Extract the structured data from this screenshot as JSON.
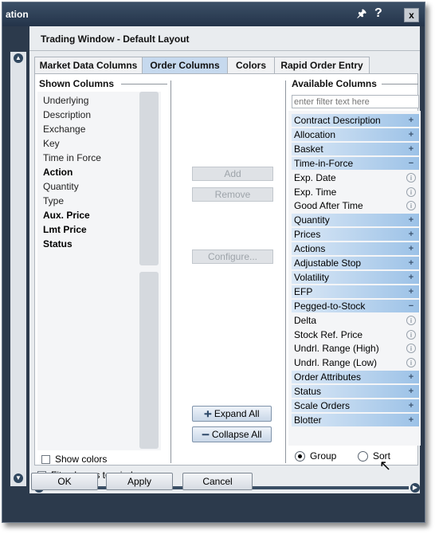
{
  "window": {
    "title": "ation",
    "pin_glyph": "▼",
    "help_glyph": "?",
    "close_glyph": "x"
  },
  "dialog": {
    "title": "Trading Window - Default Layout",
    "tabs": [
      "Market Data Columns",
      "Order Columns",
      "Colors",
      "Rapid Order Entry"
    ],
    "active_tab": "Order Columns"
  },
  "shown_columns": {
    "title": "Shown Columns",
    "items": [
      {
        "label": "Underlying",
        "bold": false
      },
      {
        "label": "Description",
        "bold": false
      },
      {
        "label": "Exchange",
        "bold": false
      },
      {
        "label": "Key",
        "bold": false
      },
      {
        "label": "Time in Force",
        "bold": false
      },
      {
        "label": "Action",
        "bold": true
      },
      {
        "label": "Quantity",
        "bold": false
      },
      {
        "label": "Type",
        "bold": false
      },
      {
        "label": "Aux. Price",
        "bold": true
      },
      {
        "label": "Lmt Price",
        "bold": true
      },
      {
        "label": "Status",
        "bold": true
      }
    ],
    "show_colors_label": "Show colors",
    "fit_columns_label": "Fit columns to window"
  },
  "middle_buttons": {
    "add": "Add",
    "remove": "Remove",
    "configure": "Configure...",
    "expand_all": "Expand All",
    "collapse_all": "Collapse All"
  },
  "available_columns": {
    "title": "Available Columns",
    "filter_placeholder": "enter filter text here",
    "items": [
      {
        "label": "Contract Description",
        "kind": "group",
        "icon": "+"
      },
      {
        "label": "Allocation",
        "kind": "group",
        "icon": "+"
      },
      {
        "label": "Basket",
        "kind": "group",
        "icon": "+"
      },
      {
        "label": "Time-in-Force",
        "kind": "group",
        "icon": "−"
      },
      {
        "label": "Exp. Date",
        "kind": "item",
        "icon": "i"
      },
      {
        "label": "Exp. Time",
        "kind": "item",
        "icon": "i"
      },
      {
        "label": "Good After Time",
        "kind": "item",
        "icon": "i"
      },
      {
        "label": "Quantity",
        "kind": "group",
        "icon": "+"
      },
      {
        "label": "Prices",
        "kind": "group",
        "icon": "+"
      },
      {
        "label": "Actions",
        "kind": "group",
        "icon": "+"
      },
      {
        "label": "Adjustable Stop",
        "kind": "group",
        "icon": "+"
      },
      {
        "label": "Volatility",
        "kind": "group",
        "icon": "+"
      },
      {
        "label": "EFP",
        "kind": "group",
        "icon": "+"
      },
      {
        "label": "Pegged-to-Stock",
        "kind": "group",
        "icon": "−"
      },
      {
        "label": "Delta",
        "kind": "item",
        "icon": "i"
      },
      {
        "label": "Stock Ref. Price",
        "kind": "item",
        "icon": "i"
      },
      {
        "label": "Undrl. Range (High)",
        "kind": "item",
        "icon": "i"
      },
      {
        "label": "Undrl. Range (Low)",
        "kind": "item",
        "icon": "i"
      },
      {
        "label": "Order Attributes",
        "kind": "group",
        "icon": "+"
      },
      {
        "label": "Status",
        "kind": "group",
        "icon": "+"
      },
      {
        "label": "Scale Orders",
        "kind": "group",
        "icon": "+"
      },
      {
        "label": "Blotter",
        "kind": "group",
        "icon": "+"
      }
    ],
    "group_label": "Group",
    "sort_label": "Sort",
    "selected_view": "Group"
  },
  "footer": {
    "ok": "OK",
    "apply": "Apply",
    "cancel": "Cancel"
  },
  "colors": {
    "group_row_start": "#dbe8f6",
    "group_row_end": "#9cc2e7",
    "active_tab": "#c6d9ee",
    "frame": "#2c3a4c"
  }
}
